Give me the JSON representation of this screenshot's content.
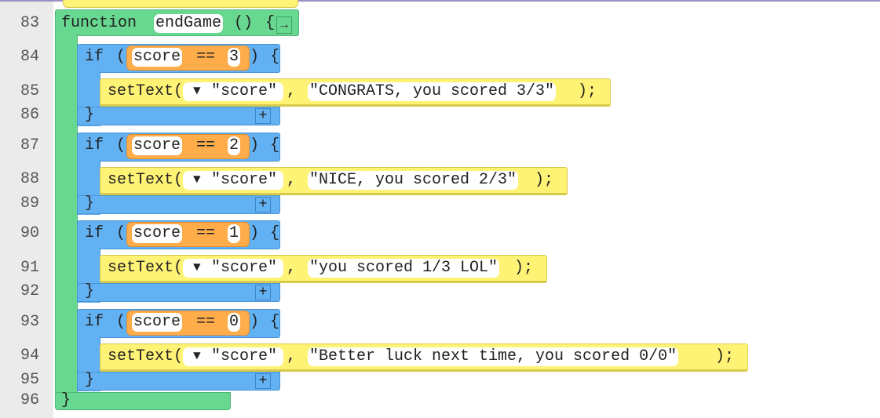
{
  "function": {
    "keyword": "function",
    "name": "endGame",
    "parens": "()",
    "open": "{",
    "close": "}",
    "collapse_icon": "arrow-right-icon"
  },
  "line_numbers": [
    "83",
    "84",
    "85",
    "86",
    "87",
    "88",
    "89",
    "90",
    "91",
    "92",
    "93",
    "94",
    "95",
    "96"
  ],
  "if_blocks": [
    {
      "keyword": "if",
      "variable": "score",
      "operator": "==",
      "value": "3",
      "open": "{",
      "close": "}",
      "call": "setText(",
      "dropdown_icon": "triangle-down-icon",
      "id_arg": "\"score\"",
      "comma": ",",
      "text_arg": "\"CONGRATS, you scored 3/3\"",
      "end": ");",
      "add": "+"
    },
    {
      "keyword": "if",
      "variable": "score",
      "operator": "==",
      "value": "2",
      "open": "{",
      "close": "}",
      "call": "setText(",
      "dropdown_icon": "triangle-down-icon",
      "id_arg": "\"score\"",
      "comma": ",",
      "text_arg": "\"NICE, you scored 2/3\"",
      "end": ");",
      "add": "+"
    },
    {
      "keyword": "if",
      "variable": "score",
      "operator": "==",
      "value": "1",
      "open": "{",
      "close": "}",
      "call": "setText(",
      "dropdown_icon": "triangle-down-icon",
      "id_arg": "\"score\"",
      "comma": ",",
      "text_arg": "\"you scored 1/3 LOL\"",
      "end": ");",
      "add": "+"
    },
    {
      "keyword": "if",
      "variable": "score",
      "operator": "==",
      "value": "0",
      "open": "{",
      "close": "}",
      "call": "setText(",
      "dropdown_icon": "triangle-down-icon",
      "id_arg": "\"score\"",
      "comma": ",",
      "text_arg": "\"Better luck next time, you scored 0/0\"",
      "end": ");",
      "add": "+"
    }
  ],
  "colors": {
    "function": "#68d890",
    "if": "#62b1f3",
    "expression": "#ffac4a",
    "call": "#fff376"
  }
}
